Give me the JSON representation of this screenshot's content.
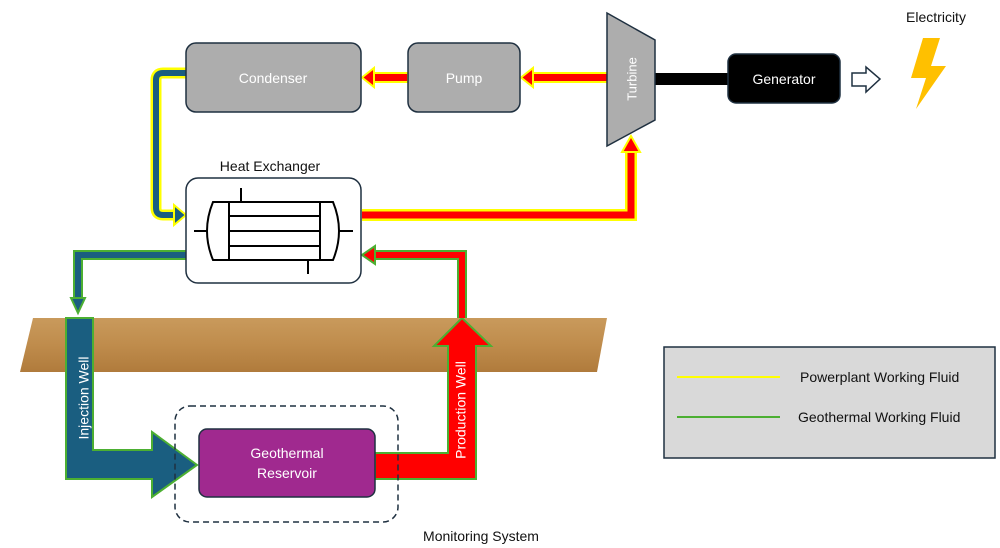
{
  "components": {
    "condenser": "Condenser",
    "pump": "Pump",
    "turbine": "Turbine",
    "generator": "Generator",
    "electricity": "Electricity",
    "heat_exchanger": "Heat Exchanger",
    "injection_well": "Injection Well",
    "production_well": "Production Well",
    "reservoir_line1": "Geothermal",
    "reservoir_line2": "Reservoir",
    "monitoring": "Monitoring System"
  },
  "legend": {
    "items": [
      {
        "label": "Powerplant Working Fluid",
        "color": "#ffff00"
      },
      {
        "label": "Geothermal Working Fluid",
        "color": "#4caf32"
      }
    ]
  },
  "colors": {
    "hot_fluid": "#ff0000",
    "cold_fluid": "#1a5e80",
    "box_gray": "#adadad",
    "reservoir": "#a0298f",
    "lightning": "#ffc000",
    "ground": "#c08a4a"
  }
}
